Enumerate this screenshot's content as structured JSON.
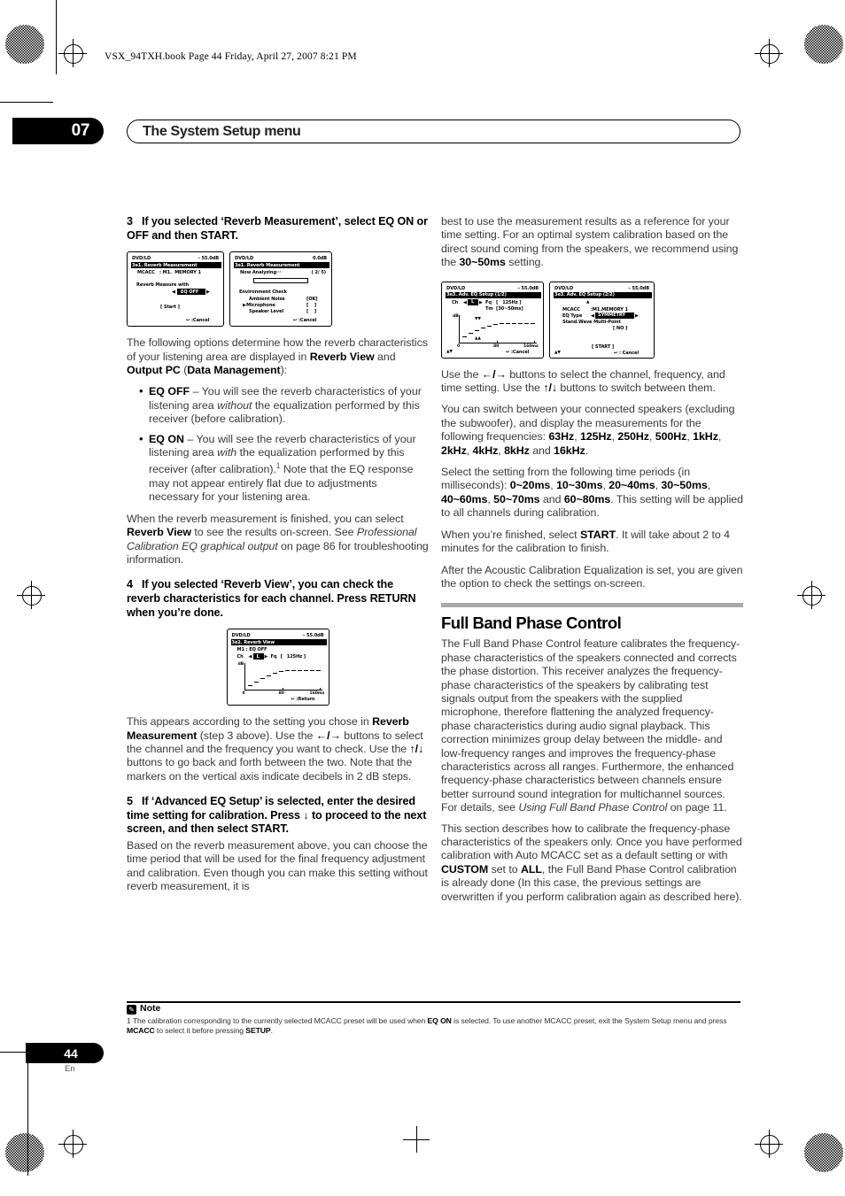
{
  "header": {
    "running_head": "VSX_94TXH.book  Page 44  Friday, April 27, 2007  8:21 PM",
    "chapter_number": "07",
    "chapter_title": "The System Setup menu"
  },
  "left_column": {
    "step3_num": "3",
    "step3_text": "If you selected ‘Reverb Measurement’, select EQ ON or OFF and then START.",
    "para1_a": "The following options determine how the reverb characteristics of your listening area are displayed in ",
    "para1_b": "Reverb View",
    "para1_c": " and ",
    "para1_d": "Output PC",
    "para1_e": " (",
    "para1_f": "Data Management",
    "para1_g": "):",
    "bullet1_label": "EQ OFF",
    "bullet1_a": " – You will see the reverb characteristics of your listening area ",
    "bullet1_i": "without",
    "bullet1_b": " the equalization performed by this receiver (before calibration).",
    "bullet2_label": "EQ ON",
    "bullet2_a": " – You will see the reverb characteristics of your listening area ",
    "bullet2_i": "with",
    "bullet2_b": " the equalization performed by this receiver (after calibration).",
    "bullet2_sup": "1",
    "bullet2_c": " Note that the EQ response may not appear entirely flat due to adjustments necessary for your listening area.",
    "para2_a": "When the reverb measurement is finished, you can select ",
    "para2_b": "Reverb View",
    "para2_c": " to see the results on-screen. See ",
    "para2_i": "Professional Calibration EQ graphical output",
    "para2_d": " on page 86 for troubleshooting information.",
    "step4_num": "4",
    "step4_text": "If you selected ‘Reverb View’, you can check the reverb characteristics for each channel. Press RETURN when you’re done.",
    "para3_a": "This appears according to the setting you chose in ",
    "para3_b": "Reverb Measurement",
    "para3_c": " (step 3 above). Use the ",
    "para3_arrows1": "←/→",
    "para3_d": " buttons to select the channel and the frequency you want to check. Use the ",
    "para3_arrows2": "↑/↓",
    "para3_e": " buttons to go back and forth between the two. Note that the markers on the vertical axis indicate decibels in 2 dB steps.",
    "step5_num": "5",
    "step5_a": "If ‘Advanced EQ Setup’ is selected, enter the desired time setting for calibration. Press ",
    "step5_arrow": "↓",
    "step5_b": " to proceed to the next screen, and then select START.",
    "para4": "Based on the reverb measurement above, you can choose the time period that will be used for the final frequency adjustment and calibration. Even though you can make this setting without reverb measurement, it is"
  },
  "right_column": {
    "para1_a": "best to use the measurement results as a reference for your time setting. For an optimal system calibration based on the direct sound coming from the speakers, we recommend using the ",
    "para1_b": "30~50ms",
    "para1_c": " setting.",
    "para2_a": "Use the ",
    "para2_arrows1": "←/→",
    "para2_b": " buttons to select the channel, frequency, and time setting. Use the ",
    "para2_arrows2": "↑/↓",
    "para2_c": " buttons to switch between them.",
    "para3_a": "You can switch between your connected speakers (excluding the subwoofer), and display the measurements for the following frequencies: ",
    "freqs": [
      "63Hz",
      "125Hz",
      "250Hz",
      "500Hz",
      "1kHz",
      "2kHz",
      "4kHz",
      "8kHz",
      "16kHz"
    ],
    "para3_and": " and ",
    "para3_end": ".",
    "para4_a": "Select the setting from the following time periods (in milliseconds): ",
    "times": [
      "0~20ms",
      "10~30ms",
      "20~40ms",
      "30~50ms",
      "40~60ms",
      "50~70ms",
      "60~80ms"
    ],
    "para4_and": " and ",
    "para4_b": ". This setting will be applied to all channels during calibration.",
    "para5_a": "When you’re finished, select ",
    "para5_b": "START",
    "para5_c": ". It will take about 2 to 4 minutes for the calibration to finish.",
    "para6": "After the Acoustic Calibration Equalization is set, you are given the option to check the settings on-screen.",
    "section_title": "Full Band Phase Control",
    "para7_a": "The Full Band Phase Control feature calibrates the frequency-phase characteristics of the speakers connected and corrects the phase distortion. This receiver analyzes the frequency-phase characteristics of the speakers by calibrating test signals output from the speakers with the supplied microphone, therefore flattening the analyzed frequency-phase characteristics during audio signal playback. This correction minimizes group delay between the middle- and low-frequency ranges and improves the frequency-phase characteristics across all ranges. Furthermore, the enhanced frequency-phase characteristics between channels ensure better surround sound integration for multichannel sources. For details, see ",
    "para7_i": "Using Full Band Phase Control",
    "para7_b": " on page 11.",
    "para8_a": "This section describes how to calibrate the frequency-phase characteristics of the speakers only. Once you have performed calibration with Auto MCACC set as a default setting or with ",
    "para8_b": "CUSTOM",
    "para8_c": " set to ",
    "para8_d": "ALL",
    "para8_e": ", the Full Band Phase Control calibration is already done (In this case, the previous settings are overwritten if you perform calibration again as described here)."
  },
  "osd_screens": {
    "reverb_measurement": {
      "source": "DVD/LD",
      "level": "– 55.0dB",
      "title": "3e1. Reverb Measurement",
      "mcacc_label": "MCACC",
      "mcacc_value": ": M1.  MEMORY 1",
      "prompt": "Reverb Measure with",
      "setting": "EQ OFF",
      "start": "[ Start ]",
      "cancel": ":Cancel"
    },
    "now_analyzing": {
      "source": "DVD/LD",
      "level": "0.0dB",
      "title": "3e1. Reverb Measurement",
      "status": "Now Analyzing···",
      "counter": "( 2/ 5)",
      "env_check": "Environment Check",
      "rows": [
        {
          "label": "Ambient Noise",
          "value": "[OK]"
        },
        {
          "label": "Microphone",
          "value": "[    ]"
        },
        {
          "label": "Speaker Level",
          "value": "[    ]"
        }
      ],
      "cancel": ":Cancel"
    },
    "reverb_view": {
      "source": "DVD/LD",
      "level": "– 55.0dB",
      "title": "3e2. Reverb View",
      "preset": "M1 : EQ OFF",
      "ch_label": "Ch",
      "ch_value": "L",
      "fq_label": "Fq",
      "fq_value": "[   125Hz ]",
      "y_label": "dB",
      "x_ticks": [
        "0",
        "80",
        "160ms"
      ],
      "return": ":Return"
    },
    "adv_eq_setup_1": {
      "source": "DVD/LD",
      "level": "– 55.0dB",
      "title": "3e3. Adv. EQ Setup (1/2)",
      "ch_label": "Ch",
      "ch_value": "L",
      "fq_label": "Fq",
      "fq_value": "[   125Hz ]",
      "tm_label": "Tm",
      "tm_value": "[30~50ms]",
      "y_label": "dB",
      "x_ticks": [
        "0",
        "80",
        "160ms"
      ],
      "cancel": ":Cancel"
    },
    "adv_eq_setup_2": {
      "source": "DVD/LD",
      "level": "– 55.0dB",
      "title": "3e3. Adv. EQ Setup (2/2)",
      "mcacc_label": "MCACC",
      "mcacc_value": ":M1.MEMORY 1",
      "eqtype_label": "EQ Type",
      "eqtype_value": "SYMMETRY",
      "stdwave_label": "Stand.Wave Multi-Point",
      "stdwave_value": "[ NO ]",
      "start": "[ START ]",
      "cancel": ": Cancel"
    }
  },
  "footnote": {
    "label": "Note",
    "icon": "note-icon",
    "text_a": "1 The calibration corresponding to the currently selected MCACC preset will be used when ",
    "text_b": "EQ ON",
    "text_c": " is selected. To use another MCACC preset, exit the System Setup menu and press ",
    "text_d": "MCACC",
    "text_e": " to select it before pressing ",
    "text_f": "SETUP",
    "text_g": "."
  },
  "footer": {
    "page_number": "44",
    "language": "En"
  }
}
